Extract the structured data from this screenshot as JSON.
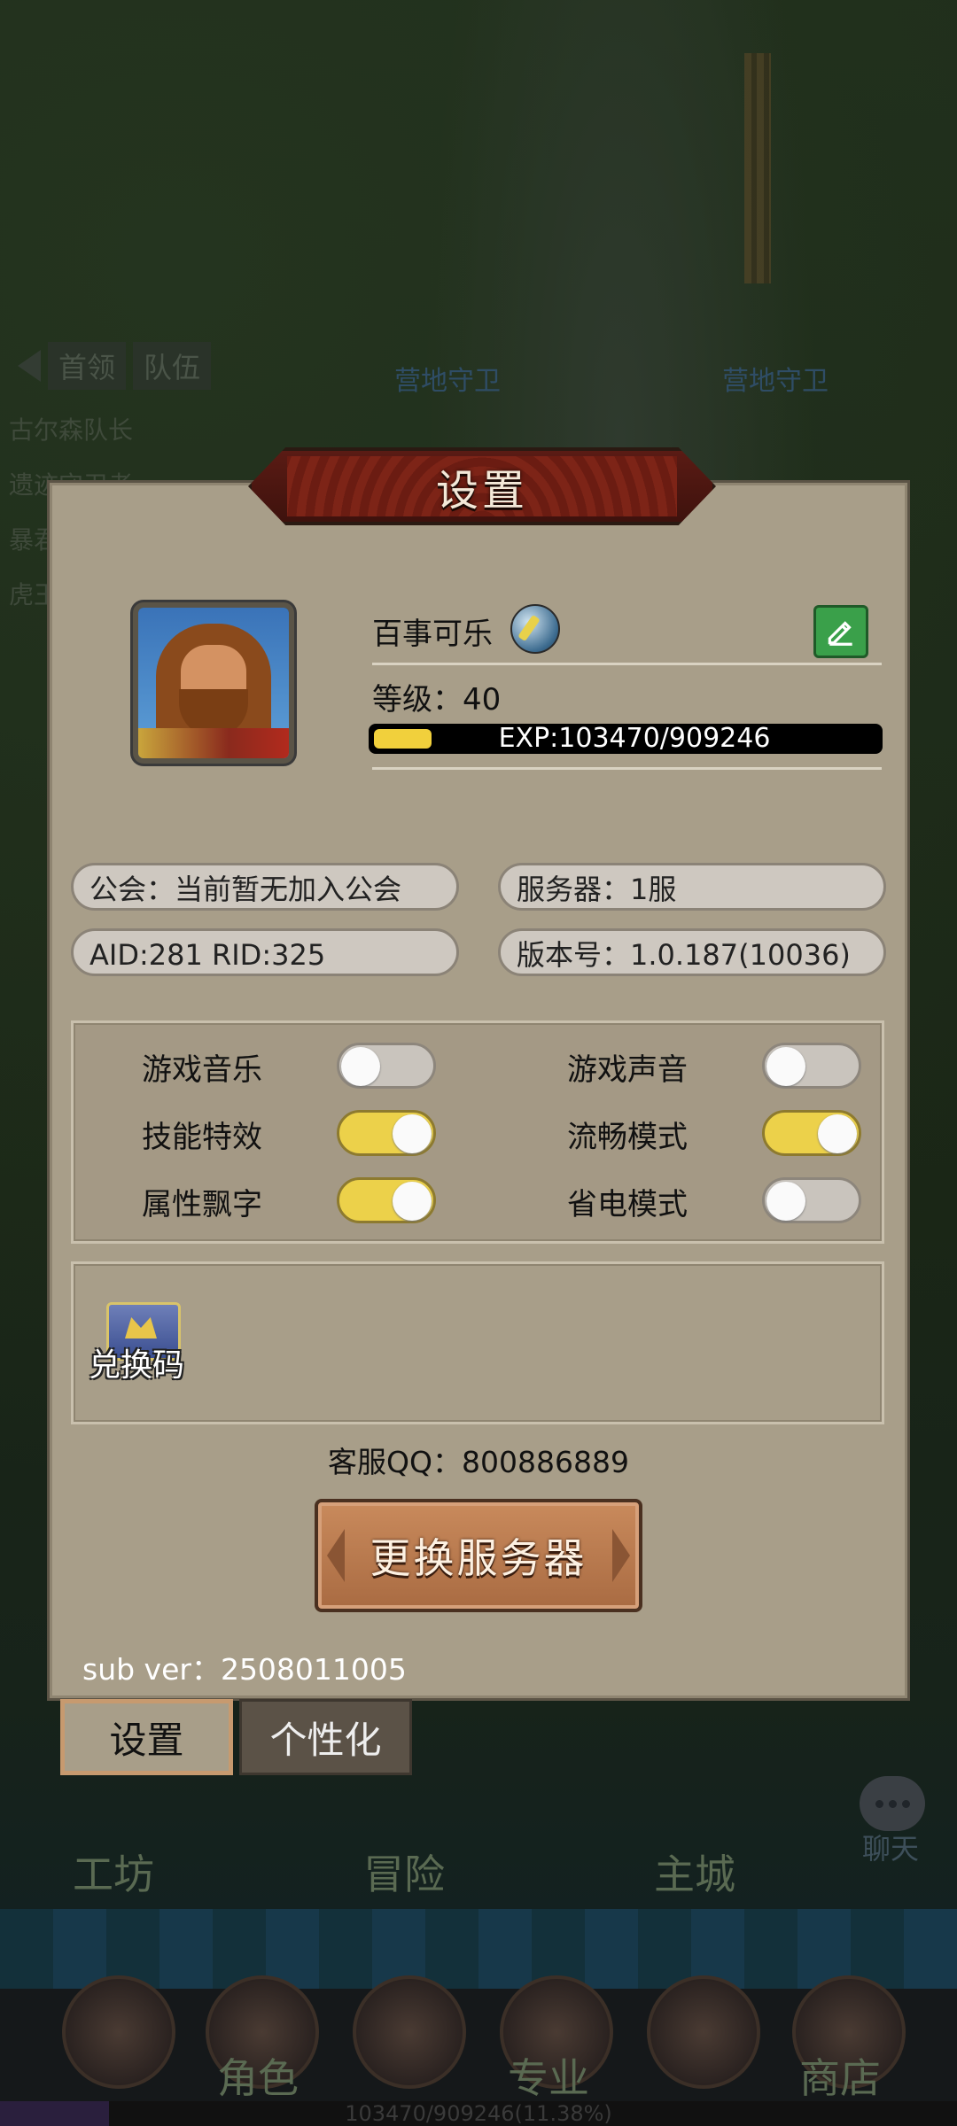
{
  "dialog": {
    "title": "设置",
    "player": {
      "name": "百事可乐",
      "level_label": "等级：40",
      "exp_text": "EXP:103470/909246",
      "exp_progress": 0.1138
    },
    "info": {
      "guild": "公会：当前暂无加入公会",
      "server": "服务器：1服",
      "ids": "AID:281   RID:325",
      "version": "版本号：1.0.187(10036)"
    },
    "settings": [
      {
        "label": "游戏音乐",
        "on": false
      },
      {
        "label": "游戏声音",
        "on": false
      },
      {
        "label": "技能特效",
        "on": true
      },
      {
        "label": "流畅模式",
        "on": true
      },
      {
        "label": "属性飘字",
        "on": true
      },
      {
        "label": "省电模式",
        "on": false
      }
    ],
    "redeem_label": "兑换码",
    "service_qq": "客服QQ：800886889",
    "change_server_label": "更换服务器",
    "sub_ver": "sub ver：2508011005"
  },
  "tabs": {
    "settings": "设置",
    "personalize": "个性化"
  },
  "background": {
    "breadcrumb": [
      "首领",
      "队伍"
    ],
    "side_list": [
      "古尔森队长",
      "遗迹守卫者",
      "暴君",
      "虎王"
    ],
    "enemy_labels": [
      "营地守卫",
      "营地守卫"
    ],
    "nav_top": [
      "工坊",
      "冒险",
      "主城"
    ],
    "nav_bottom": [
      "角色",
      "专业",
      "商店"
    ],
    "chat_label": "聊天",
    "bottom_progress": "103470/909246(11.38%)"
  },
  "colors": {
    "panel": "#a89e89",
    "toggle_on": "#ecd14a",
    "toggle_off": "#c9c4bd",
    "exp_fill": "#f1d03c",
    "edit_button": "#3aa04a"
  }
}
